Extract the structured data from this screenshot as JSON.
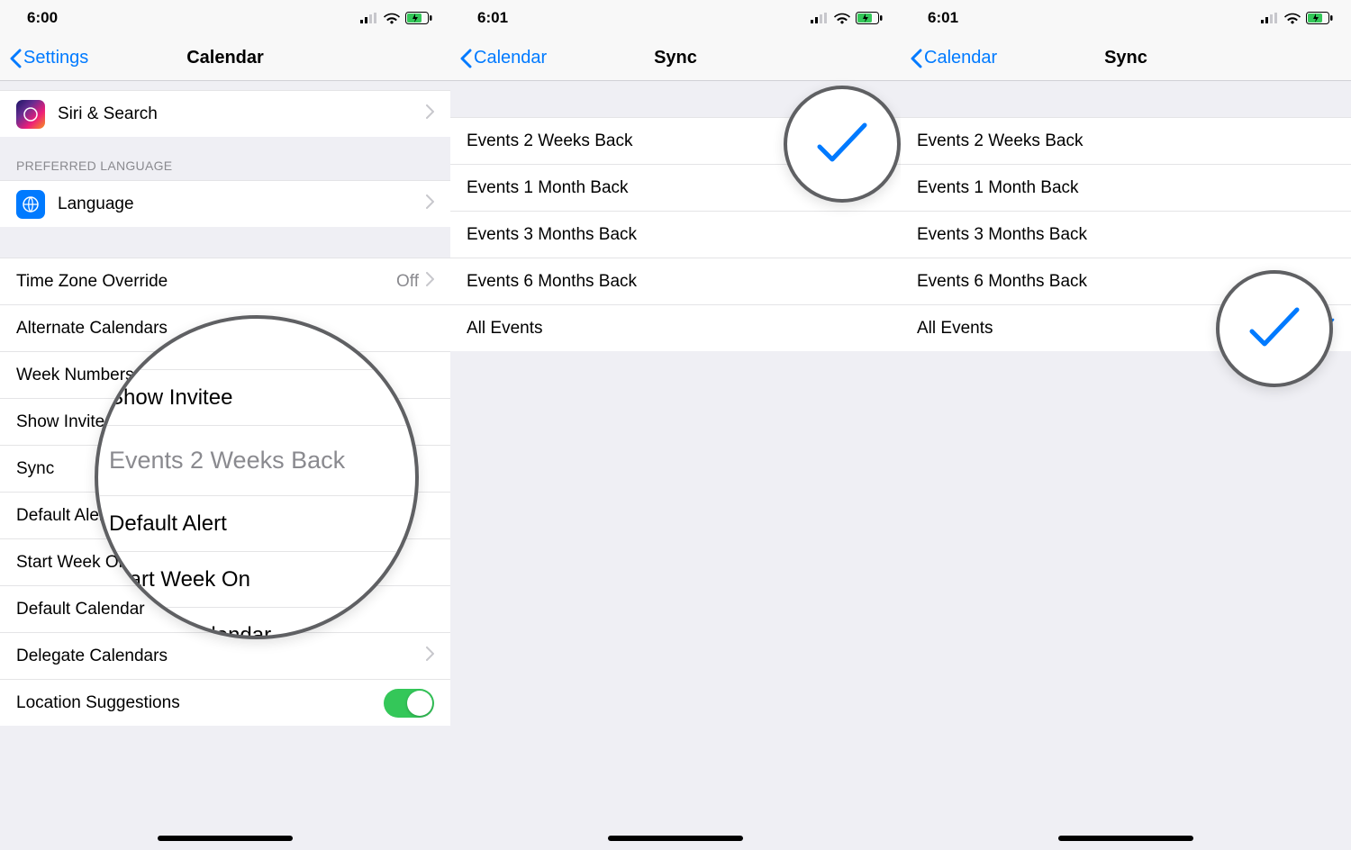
{
  "phones": [
    {
      "status_time": "6:00",
      "nav_back": "Settings",
      "nav_title": "Calendar",
      "magnifier_value": "Events 2 Weeks Back",
      "siri_label": "Siri & Search",
      "pref_lang_header": "PREFERRED LANGUAGE",
      "language_label": "Language",
      "rows": {
        "tz": {
          "label": "Time Zone Override",
          "value": "Off"
        },
        "alt": {
          "label": "Alternate Calendars"
        },
        "week": {
          "label": "Week Numbers"
        },
        "show": {
          "label": "Show Invitee"
        },
        "sync": {
          "label": "Sync",
          "value": "Events 2 Weeks Back"
        },
        "alert": {
          "label": "Default Alert"
        },
        "start": {
          "label": "Start Week On"
        },
        "defcal": {
          "label": "Default Calendar"
        },
        "delegate": {
          "label": "Delegate Calendars"
        },
        "loc": {
          "label": "Location Suggestions"
        }
      }
    },
    {
      "status_time": "6:01",
      "nav_back": "Calendar",
      "nav_title": "Sync",
      "options": [
        "Events 2 Weeks Back",
        "Events 1 Month Back",
        "Events 3 Months Back",
        "Events 6 Months Back",
        "All Events"
      ],
      "selected_index": 0
    },
    {
      "status_time": "6:01",
      "nav_back": "Calendar",
      "nav_title": "Sync",
      "options": [
        "Events 2 Weeks Back",
        "Events 1 Month Back",
        "Events 3 Months Back",
        "Events 6 Months Back",
        "All Events"
      ],
      "selected_index": 4
    }
  ]
}
